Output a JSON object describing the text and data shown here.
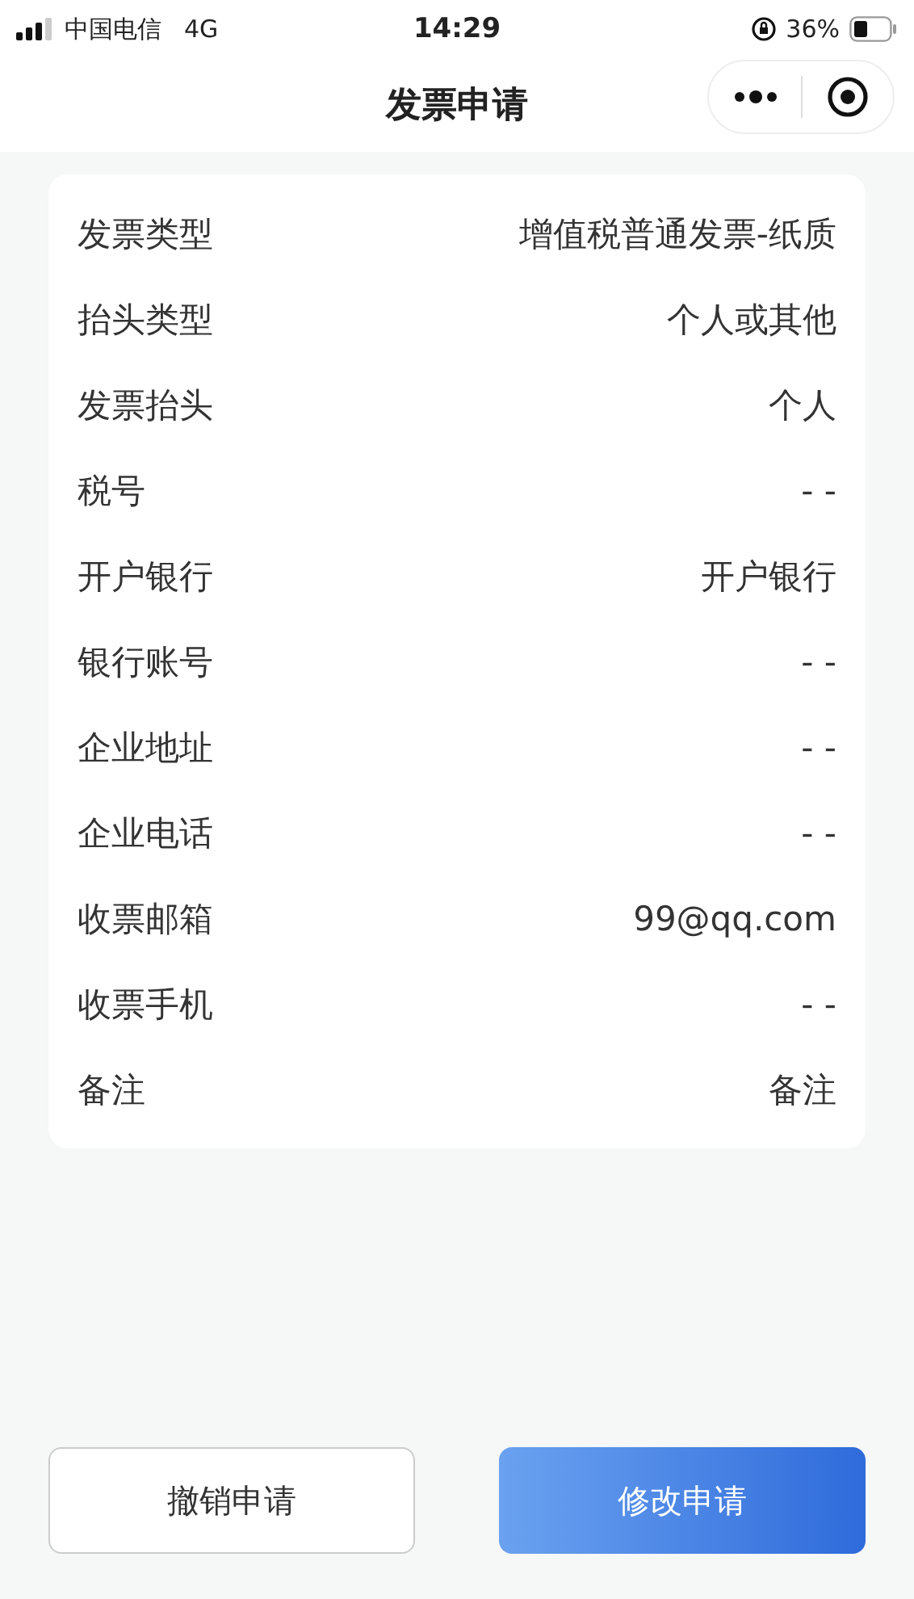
{
  "status_bar": {
    "carrier": "中国电信",
    "network": "4G",
    "time": "14:29",
    "battery": "36%"
  },
  "nav": {
    "title": "发票申请"
  },
  "details": [
    {
      "label": "发票类型",
      "value": "增值税普通发票-纸质"
    },
    {
      "label": "抬头类型",
      "value": "个人或其他"
    },
    {
      "label": "发票抬头",
      "value": "个人"
    },
    {
      "label": "税号",
      "value": "- -"
    },
    {
      "label": "开户银行",
      "value": "开户银行"
    },
    {
      "label": "银行账号",
      "value": "- -"
    },
    {
      "label": "企业地址",
      "value": "- -"
    },
    {
      "label": "企业电话",
      "value": "- -"
    },
    {
      "label": "收票邮箱",
      "value": "99@qq.com"
    },
    {
      "label": "收票手机",
      "value": "- -"
    },
    {
      "label": "备注",
      "value": "备注"
    }
  ],
  "buttons": [
    {
      "label": "撤销申请",
      "kind": "secondary"
    },
    {
      "label": "修改申请",
      "kind": "primary"
    }
  ]
}
